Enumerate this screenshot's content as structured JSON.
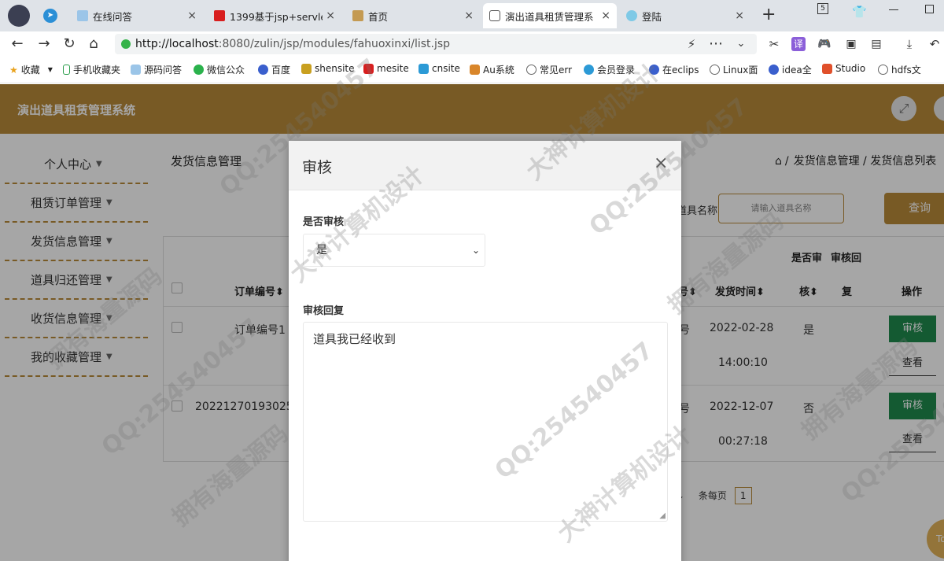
{
  "browser": {
    "tabs": [
      {
        "title": "在线问答",
        "active": false
      },
      {
        "title": "1399基于jsp+servle",
        "active": false
      },
      {
        "title": "首页",
        "active": false
      },
      {
        "title": "演出道具租赁管理系",
        "active": true
      },
      {
        "title": "登陆",
        "active": false
      }
    ],
    "new_tab": "+",
    "tab_count_badge": "5",
    "url_host": "http://localhost",
    "url_rest": ":8080/zulin/jsp/modules/fahuoxinxi/list.jsp",
    "bookmarks": [
      "收藏",
      "手机收藏夹",
      "源码问答",
      "微信公众",
      "百度",
      "shensite",
      "mesite",
      "cnsite",
      "Au系统",
      "常见err",
      "会员登录",
      "在eclips",
      "Linux面",
      "idea全",
      "Studio",
      "hdfs文"
    ]
  },
  "app": {
    "title": "演出道具租赁管理系统",
    "menu": [
      "个人中心",
      "租赁订单管理",
      "发货信息管理",
      "道具归还管理",
      "收货信息管理",
      "我的收藏管理"
    ],
    "page_title": "发货信息管理",
    "breadcrumb": "发货信息管理 / 发货信息列表",
    "breadcrumb_sep": "/",
    "search": {
      "label": "道具名称",
      "placeholder": "请输入道具名称",
      "button": "查询"
    },
    "table": {
      "headers": {
        "order_no": "订单编号",
        "col_hao": "号",
        "send_time": "发货时间",
        "audit_top": "是否审",
        "audit_bottom": "核",
        "reply_top": "审核回",
        "reply_bottom": "复",
        "ops": "操作"
      },
      "sort_mark": "⬍",
      "rows": [
        {
          "order_no": "订单编号1",
          "col_hao": "号",
          "date": "2022-02-28",
          "time": "14:00:10",
          "audit": "是",
          "btn_audit": "审核",
          "btn_view": "查看"
        },
        {
          "order_no": "20221270193025",
          "col_hao": "号",
          "date": "2022-12-07",
          "time": "00:27:18",
          "audit": "否",
          "btn_audit": "审核",
          "btn_view": "查看"
        }
      ]
    },
    "pager": {
      "per_page": "条每页",
      "current": "1"
    },
    "to_top": "To"
  },
  "modal": {
    "title": "审核",
    "close": "×",
    "audit_label": "是否审核",
    "audit_value": "是",
    "reply_label": "审核回复",
    "reply_value": "道具我已经收到"
  },
  "watermark": [
    "QQ:254540457",
    "大神计算机设计",
    "拥有海量源码"
  ]
}
